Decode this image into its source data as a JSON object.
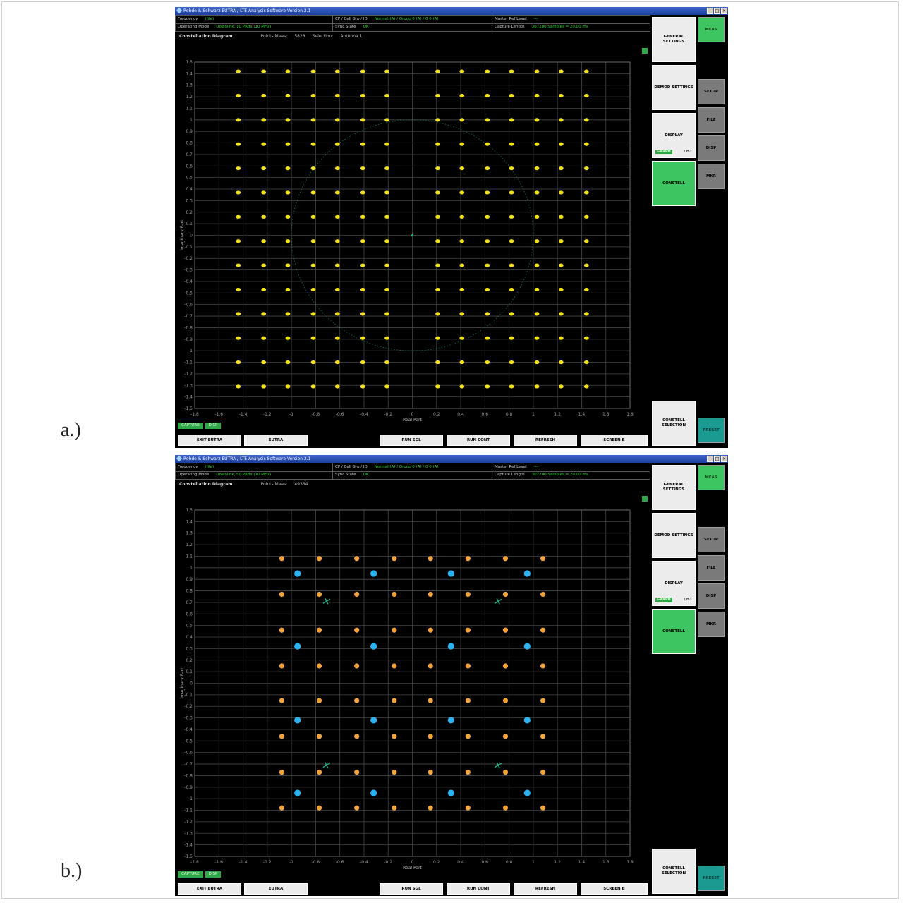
{
  "labels": {
    "a": "a.)",
    "b": "b.)"
  },
  "colors": {
    "window_bg": "#000000",
    "grid": "#4a4a4a",
    "yellow": "#f2e21a",
    "orange": "#f3a33c",
    "cyan": "#2ab3f0",
    "teal": "#18b890",
    "green_ui": "#3cc560"
  },
  "windows": [
    {
      "title": "Rohde & Schwarz EUTRA / LTE Analysis Software Version 2.1",
      "header": {
        "row1": [
          {
            "k": "Frequency",
            "v": "(file)"
          },
          {
            "k": "CP / Cell Grp / ID",
            "v": "Normal (A) / Group 0 (A) / 0 0 (A)"
          },
          {
            "k": "Master Ref Level",
            "v": "---"
          }
        ],
        "row2": [
          {
            "k": "Operating Mode",
            "v": "Downlink, 10 PRBs (10 MHz)"
          },
          {
            "k": "Sync State",
            "v": "OK"
          },
          {
            "k": "Capture Length",
            "v": "307200 Samples = 20.00 ms"
          }
        ]
      },
      "display_title": "Constellation Diagram",
      "points_label": "Points Meas:",
      "points_value": "5828",
      "selection_label": "Selection:",
      "selection_value": "Antenna 1",
      "xlabel": "Real Part",
      "ylabel": "Imaginary Part",
      "capture": [
        "CAPTURE",
        "DISP"
      ],
      "softkeys": [
        "EXIT EUTRA",
        "EUTRA",
        "RUN SGL",
        "RUN CONT",
        "REFRESH",
        "SCREEN B"
      ],
      "right_buttons": [
        "GENERAL SETTINGS",
        "DEMOD SETTINGS",
        "DISPLAY",
        "CONSTELL",
        "CONSTELL SELECTION"
      ],
      "display_sub": [
        "GRAPH",
        "LIST"
      ],
      "side_buttons": [
        "MEAS",
        "SETUP",
        "FILE",
        "DISP",
        "MKR",
        "PRESET"
      ]
    },
    {
      "title": "Rohde & Schwarz EUTRA / LTE Analysis Software Version 2.1",
      "header": {
        "row1": [
          {
            "k": "Frequency",
            "v": "(file)"
          },
          {
            "k": "CP / Cell Grp / ID",
            "v": "Normal (A) / Group 0 (A) / 0 0 (A)"
          },
          {
            "k": "Master Ref Level",
            "v": "---"
          }
        ],
        "row2": [
          {
            "k": "Operating Mode",
            "v": "Downlink, 50 PRBs (10 MHz)"
          },
          {
            "k": "Sync State",
            "v": "OK"
          },
          {
            "k": "Capture Length",
            "v": "307200 Samples = 20.00 ms"
          }
        ]
      },
      "display_title": "Constellation Diagram",
      "points_label": "Points Meas:",
      "points_value": "49334",
      "selection_label": "",
      "selection_value": "",
      "xlabel": "Real Part",
      "ylabel": "Imaginary Part",
      "capture": [
        "CAPTURE",
        "DISP"
      ],
      "softkeys": [
        "EXIT EUTRA",
        "EUTRA",
        "RUN SGL",
        "RUN CONT",
        "REFRESH",
        "SCREEN B"
      ],
      "right_buttons": [
        "GENERAL SETTINGS",
        "DEMOD SETTINGS",
        "DISPLAY",
        "CONSTELL",
        "CONSTELL SELECTION"
      ],
      "display_sub": [
        "GRAPH",
        "LIST"
      ],
      "side_buttons": [
        "MEAS",
        "SETUP",
        "FILE",
        "DISP",
        "MKR",
        "PRESET"
      ]
    }
  ],
  "chart_data": [
    {
      "type": "scatter",
      "title": "Constellation Diagram",
      "xlabel": "Real Part",
      "ylabel": "Imaginary Part",
      "xlim": [
        -1.8,
        1.8
      ],
      "ylim": [
        -1.5,
        1.5
      ],
      "xticks": [
        -1.8,
        -1.6,
        -1.4,
        -1.2,
        -1,
        -0.8,
        -0.6,
        -0.4,
        -0.2,
        0,
        0.2,
        0.4,
        0.6,
        0.8,
        1,
        1.2,
        1.4,
        1.6,
        1.8
      ],
      "yticks": [
        1.5,
        1.4,
        1.3,
        1.2,
        1.1,
        1,
        0.9,
        0.8,
        0.7,
        0.6,
        0.5,
        0.4,
        0.3,
        0.2,
        0.1,
        0,
        -0.1,
        -0.2,
        -0.3,
        -0.4,
        -0.5,
        -0.6,
        -0.7,
        -0.8,
        -0.9,
        -1,
        -1.1,
        -1.2,
        -1.3,
        -1.4,
        -1.5
      ],
      "grid": true,
      "series": [
        {
          "color": "#f2e21a",
          "grid_levels": [
            -1.44,
            -1.23,
            -1.03,
            -0.82,
            -0.62,
            -0.41,
            -0.21,
            0,
            0.21,
            0.41,
            0.62,
            0.82,
            1.03,
            1.23,
            1.44
          ],
          "y_levels": [
            1.42,
            1.21,
            1.0,
            0.79,
            0.58,
            0.37,
            0.16,
            -0.05,
            -0.26,
            -0.47,
            -0.68,
            -0.89,
            -1.1,
            -1.31
          ],
          "note": "64QAM 14x14 grid (excluding center column)"
        },
        {
          "color": "#18b890",
          "circle_radius": 1.0,
          "center": [
            0,
            0
          ]
        }
      ]
    },
    {
      "type": "scatter",
      "title": "Constellation Diagram",
      "xlabel": "Real Part",
      "ylabel": "Imaginary Part",
      "xlim": [
        -1.8,
        1.8
      ],
      "ylim": [
        -1.5,
        1.5
      ],
      "xticks": [
        -1.8,
        -1.6,
        -1.4,
        -1.2,
        -1,
        -0.8,
        -0.6,
        -0.4,
        -0.2,
        0,
        0.2,
        0.4,
        0.6,
        0.8,
        1,
        1.2,
        1.4,
        1.6,
        1.8
      ],
      "yticks": [
        1.5,
        1.4,
        1.3,
        1.2,
        1.1,
        1,
        0.9,
        0.8,
        0.7,
        0.6,
        0.5,
        0.4,
        0.3,
        0.2,
        0.1,
        0,
        -0.1,
        -0.2,
        -0.3,
        -0.4,
        -0.5,
        -0.6,
        -0.7,
        -0.8,
        -0.9,
        -1,
        -1.1,
        -1.2,
        -1.3,
        -1.4,
        -1.5
      ],
      "grid": true,
      "series": [
        {
          "color": "#f3a33c",
          "x": [
            -1.08,
            -0.77,
            -0.46,
            -0.15,
            0.15,
            0.46,
            0.77,
            1.08
          ],
          "y": [
            1.08,
            0.77,
            0.46,
            0.15,
            -0.15,
            -0.46,
            -0.77,
            -1.08
          ]
        },
        {
          "color": "#2ab3f0",
          "x": [
            -0.95,
            -0.32,
            0.32,
            0.95
          ],
          "y": [
            0.95,
            0.32,
            -0.32,
            -0.95
          ]
        },
        {
          "color": "#18b890",
          "x": [
            -0.71,
            0.71
          ],
          "y": [
            0.71,
            -0.71
          ]
        }
      ]
    }
  ]
}
